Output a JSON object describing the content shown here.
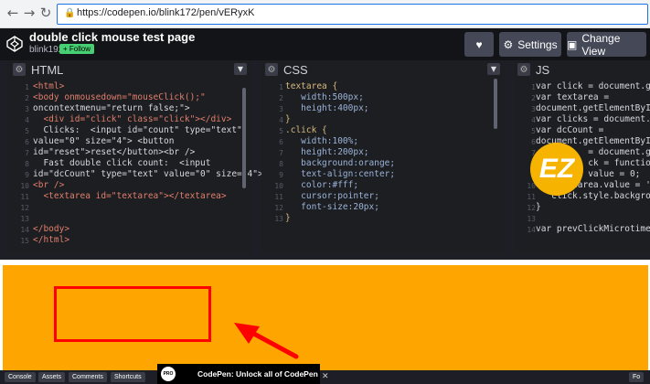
{
  "browser": {
    "url": "https://codepen.io/blink172/pen/vERyxK"
  },
  "codepen": {
    "title": "double click mouse test page",
    "author": "blink192",
    "follow_label": "+ Follow",
    "settings_label": "Settings",
    "change_view_label": "Change View"
  },
  "editors": {
    "html": {
      "title": "HTML",
      "lines": [
        "<html>",
        "<body onmousedown=\"mouseClick();\"",
        "oncontextmenu=\"return false;\">",
        "  <div id=\"click\" class=\"click\"></div>",
        "  Clicks:  <input id=\"count\" type=\"text\"",
        "value=\"0\" size=\"4\"> <button",
        "id=\"reset\">reset</button><br />",
        "  Fast double click count:  <input",
        "id=\"dcCount\" type=\"text\" value=\"0\" size=\"4\">",
        "<br />",
        "  <textarea id=\"textarea\"></textarea>",
        "",
        "",
        "</body>",
        "</html>"
      ]
    },
    "css": {
      "title": "CSS",
      "lines": [
        "textarea {",
        "   width:500px;",
        "   height:400px;",
        "}",
        ".click {",
        "   width:100%;",
        "   height:200px;",
        "   background:orange;",
        "   text-align:center;",
        "   color:#fff;",
        "   cursor:pointer;",
        "   font-size:20px;",
        "}"
      ]
    },
    "js": {
      "title": "JS",
      "lines": [
        "var click = document.getEle",
        "var textarea =",
        "document.getElementById('te",
        "var clicks = document.getEl",
        "var dcCount =",
        "document.getElementById('dc",
        "          = document.getEle",
        "          ck = function()",
        "          value = 0;",
        "    textarea.value = '';",
        "   click.style.background =",
        "}",
        "",
        "var prevClickMicrotime = mi"
      ]
    }
  },
  "bottom": {
    "buttons": [
      "Console",
      "Assets",
      "Comments",
      "Shortcuts"
    ],
    "promo_badge": "PRO",
    "promo_text": "CodePen: Unlock all of CodePen",
    "right_label": "Fo"
  },
  "watermark": "EZ",
  "colors": {
    "result_bg": "#ffa500",
    "highlight": "#ff0000",
    "follow": "#47cf73"
  }
}
